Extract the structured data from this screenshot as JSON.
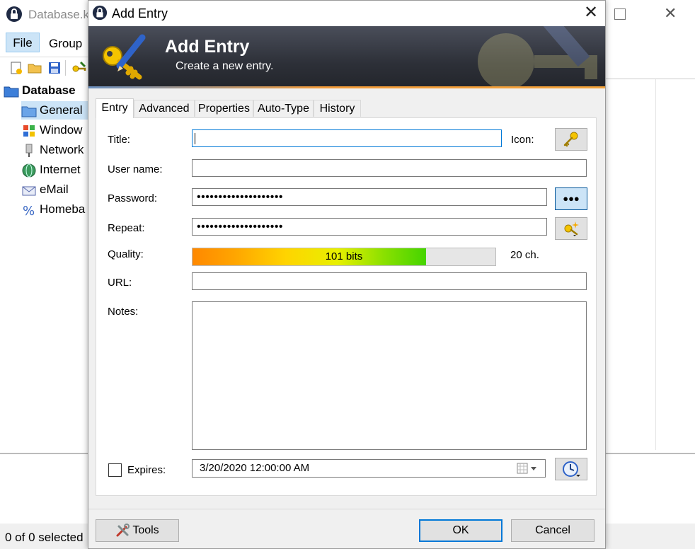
{
  "main": {
    "window_title": "Database.k",
    "menu": {
      "file": "File",
      "group": "Group"
    },
    "tree": {
      "root": "Database",
      "items": [
        {
          "label": "General",
          "icon": "folder-icon"
        },
        {
          "label": "Window",
          "icon": "windows-icon"
        },
        {
          "label": "Network",
          "icon": "network-icon"
        },
        {
          "label": "Internet",
          "icon": "globe-icon"
        },
        {
          "label": "eMail",
          "icon": "envelope-icon"
        },
        {
          "label": "Homeba",
          "icon": "percent-icon"
        }
      ]
    },
    "status": "0 of 0 selected"
  },
  "dialog": {
    "title": "Add Entry",
    "banner": {
      "title": "Add Entry",
      "subtitle": "Create a new entry."
    },
    "tabs": [
      "Entry",
      "Advanced",
      "Properties",
      "Auto-Type",
      "History"
    ],
    "active_tab": "Entry",
    "form": {
      "title_label": "Title:",
      "title_value": "",
      "icon_label": "Icon:",
      "username_label": "User name:",
      "username_value": "",
      "password_label": "Password:",
      "password_value": "••••••••••••••••••••",
      "show_password_glyph": "●●●",
      "repeat_label": "Repeat:",
      "repeat_value": "••••••••••••••••••••",
      "quality_label": "Quality:",
      "quality_text": "101 bits",
      "quality_fraction": 0.77,
      "char_count": "20 ch.",
      "url_label": "URL:",
      "url_value": "",
      "notes_label": "Notes:",
      "notes_value": "",
      "expires_label": "Expires:",
      "expires_checked": false,
      "expires_value": "3/20/2020 12:00:00 AM"
    },
    "buttons": {
      "tools": "Tools",
      "ok": "OK",
      "cancel": "Cancel"
    }
  },
  "colors": {
    "accent": "#0078d7",
    "banner_dark": "#2d3038",
    "banner_stripe": "#f29b3a"
  }
}
